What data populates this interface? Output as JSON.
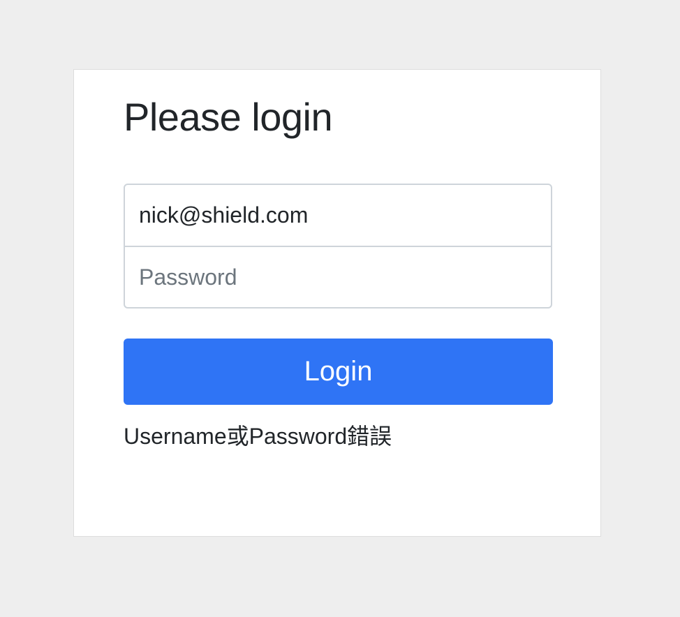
{
  "login_form": {
    "title": "Please login",
    "email_value": "nick@shield.com",
    "password_placeholder": "Password",
    "login_label": "Login",
    "error_message": "Username或Password錯誤"
  },
  "colors": {
    "page_background": "#eeeeee",
    "card_background": "#ffffff",
    "primary_button": "#2f74f5",
    "text": "#212529",
    "placeholder": "#6c757d"
  }
}
